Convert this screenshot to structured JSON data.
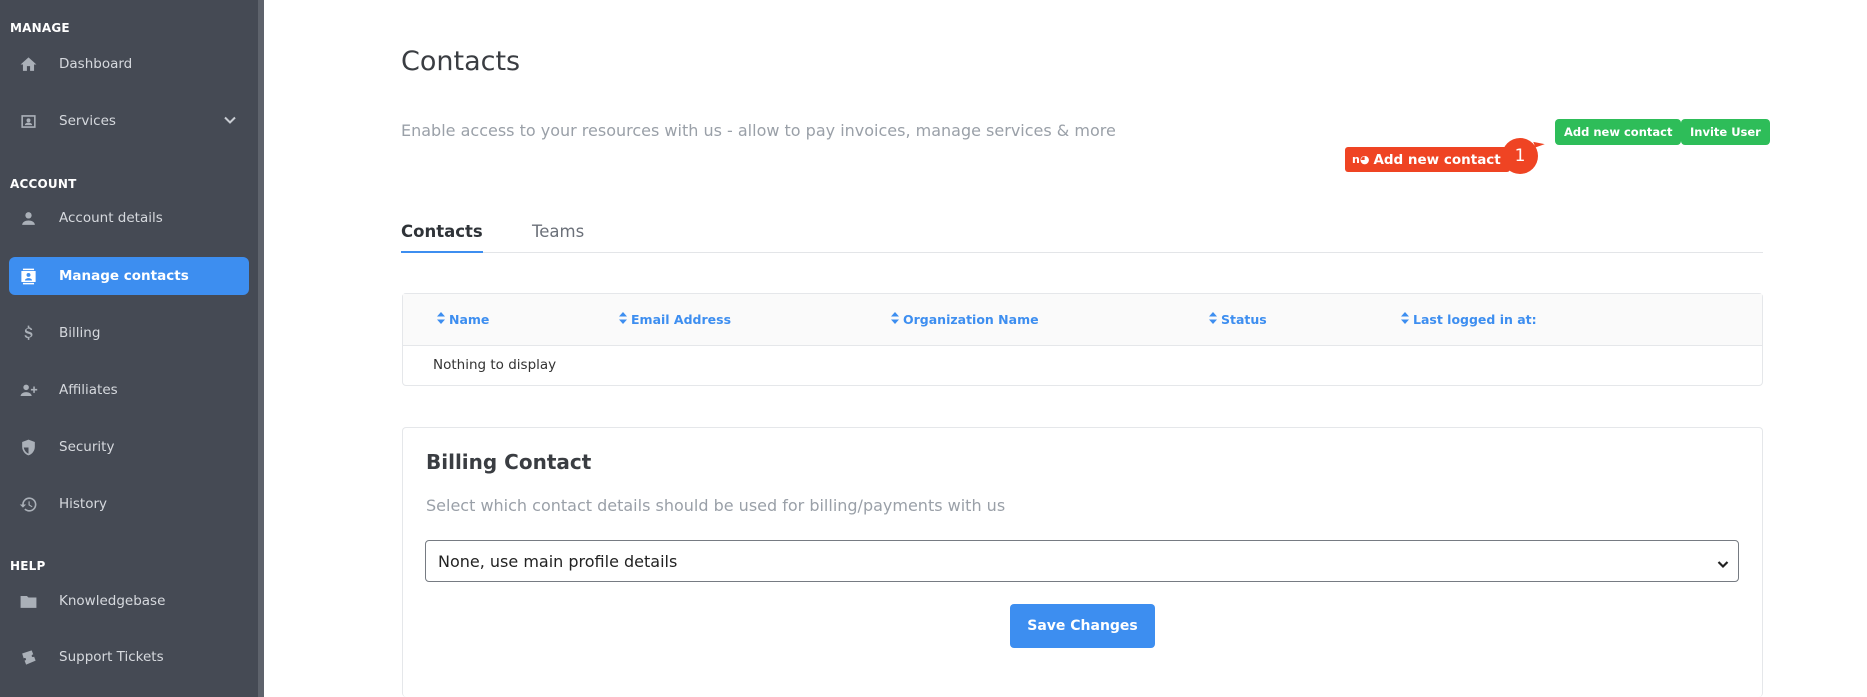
{
  "sidebar": {
    "sections": {
      "manage": "MANAGE",
      "account": "ACCOUNT",
      "help": "HELP"
    },
    "items": [
      {
        "label": "Dashboard",
        "icon": "home-icon"
      },
      {
        "label": "Services",
        "icon": "id-card-icon"
      },
      {
        "label": "Account details",
        "icon": "user-icon"
      },
      {
        "label": "Manage contacts",
        "icon": "contacts-icon"
      },
      {
        "label": "Billing",
        "icon": "dollar-icon"
      },
      {
        "label": "Affiliates",
        "icon": "user-plus-icon"
      },
      {
        "label": "Security",
        "icon": "shield-icon"
      },
      {
        "label": "History",
        "icon": "history-icon"
      },
      {
        "label": "Knowledgebase",
        "icon": "folder-icon"
      },
      {
        "label": "Support Tickets",
        "icon": "tickets-icon"
      }
    ],
    "active_item": "Manage contacts"
  },
  "main": {
    "title": "Contacts",
    "subtitle": "Enable access to your resources with us - allow to pay invoices, manage services & more",
    "buttons": {
      "add_contact": "Add new contact",
      "invite_user": "Invite User",
      "overlay_add_contact": "Add new contact",
      "overlay_prefix": "n◕"
    },
    "badge_count": "1",
    "tabs": [
      {
        "label": "Contacts",
        "active": true
      },
      {
        "label": "Teams",
        "active": false
      }
    ],
    "table": {
      "columns": [
        "Name",
        "Email Address",
        "Organization Name",
        "Status",
        "Last logged in at:"
      ],
      "empty_text": "Nothing to display"
    },
    "billing": {
      "title": "Billing Contact",
      "subtitle": "Select which contact details should be used for billing/payments with us",
      "selected_option": "None, use main profile details",
      "save_label": "Save Changes"
    }
  },
  "colors": {
    "sidebar_bg": "#454a54",
    "accent_blue": "#3d8ef0",
    "green": "#2ebd59",
    "red": "#ef4423"
  }
}
